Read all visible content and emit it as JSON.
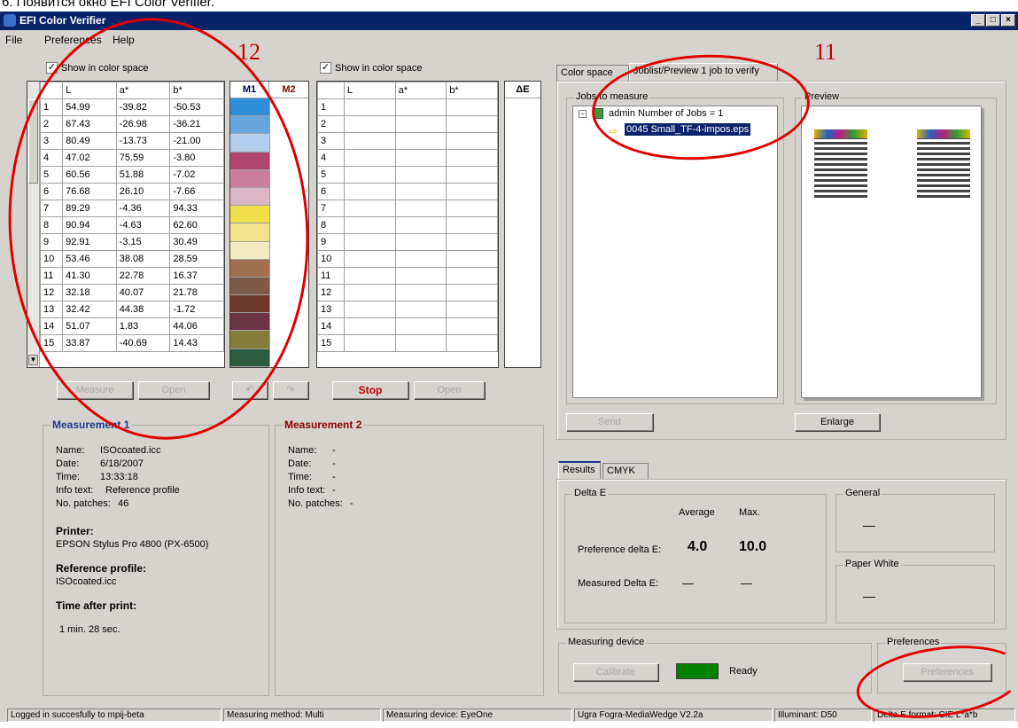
{
  "caption": "6. Появится окно EFI Color Verifier.",
  "window": {
    "title": "EFI Color Verifier",
    "minimize": "_",
    "maximize": "□",
    "close": "×"
  },
  "menu": [
    "File",
    "Preferences",
    "Help"
  ],
  "show_color_space": "Show in color space",
  "m1_table": {
    "headers": [
      "L",
      "a*",
      "b*"
    ],
    "rows": [
      [
        "1",
        "54.99",
        "-39.82",
        "-50.53"
      ],
      [
        "2",
        "67.43",
        "-26.98",
        "-36.21"
      ],
      [
        "3",
        "80.49",
        "-13.73",
        "-21.00"
      ],
      [
        "4",
        "47.02",
        "75.59",
        "-3.80"
      ],
      [
        "5",
        "60.56",
        "51.88",
        "-7.02"
      ],
      [
        "6",
        "76.68",
        "26.10",
        "-7.66"
      ],
      [
        "7",
        "89.29",
        "-4.36",
        "94.33"
      ],
      [
        "8",
        "90.94",
        "-4.63",
        "62.60"
      ],
      [
        "9",
        "92.91",
        "-3.15",
        "30.49"
      ],
      [
        "10",
        "53.46",
        "38.08",
        "28.59"
      ],
      [
        "11",
        "41.30",
        "22.78",
        "16.37"
      ],
      [
        "12",
        "32.18",
        "40.07",
        "21.78"
      ],
      [
        "13",
        "32.42",
        "44.38",
        "-1.72"
      ],
      [
        "14",
        "51.07",
        "1.83",
        "44.06"
      ],
      [
        "15",
        "33.87",
        "-40.69",
        "14.43"
      ]
    ]
  },
  "swatch_headers": [
    "M1",
    "M2"
  ],
  "swatch_colors": [
    "#2f8ed8",
    "#66a6dc",
    "#b3cdec",
    "#b0466e",
    "#cc7f9c",
    "#dcb7c6",
    "#f0e14c",
    "#f4e28a",
    "#f3ebc0",
    "#a07050",
    "#7d5a4a",
    "#6e3a30",
    "#6a3444",
    "#857b3a",
    "#2e5c40"
  ],
  "m2_table": {
    "headers": [
      "L",
      "a*",
      "b*"
    ],
    "row_numbers": [
      "1",
      "2",
      "3",
      "4",
      "5",
      "6",
      "7",
      "8",
      "9",
      "10",
      "11",
      "12",
      "13",
      "14",
      "15"
    ]
  },
  "delta_e_header": "ΔE",
  "buttons": {
    "measure1": "Measure",
    "open1": "Open",
    "undo": "↶",
    "redo": "↷",
    "stop": "Stop",
    "open2": "Open",
    "send": "Send",
    "enlarge": "Enlarge",
    "calibrate": "Calibrate",
    "preferences": "Preferences"
  },
  "measurement1": {
    "title": "Measurement 1",
    "name_label": "Name:",
    "name": "ISOcoated.icc",
    "date_label": "Date:",
    "date": "6/18/2007",
    "time_label": "Time:",
    "time": "13:33:18",
    "info_label": "Info text:",
    "info": "Reference profile",
    "patches_label": "No. patches:",
    "patches": "46",
    "printer_label": "Printer:",
    "printer": "EPSON Stylus Pro 4800 (PX-6500)",
    "ref_label": "Reference profile:",
    "ref": "ISOcoated.icc",
    "tap_label": "Time after print:",
    "tap": "1 min. 28 sec."
  },
  "measurement2": {
    "title": "Measurement 2",
    "name_label": "Name:",
    "name": "-",
    "date_label": "Date:",
    "date": "-",
    "time_label": "Time:",
    "time": "-",
    "info_label": "Info text:",
    "info": "-",
    "patches_label": "No. patches:",
    "patches": "-"
  },
  "top_tabs": [
    "Color space",
    "Joblist/Preview  1 job to verify"
  ],
  "jobs": {
    "group": "Jobs to measure",
    "root": "admin  Number of Jobs = 1",
    "job": "0045 Small_TF-4-impos.eps",
    "expander": "−"
  },
  "preview_group": "Preview",
  "results_tabs": [
    "Results",
    "CMYK"
  ],
  "delta_e": {
    "group": "Delta E",
    "avg_label": "Average",
    "max_label": "Max.",
    "pref_label": "Preference delta E:",
    "pref_avg": "4.0",
    "pref_max": "10.0",
    "meas_label": "Measured  Delta E:",
    "meas_avg": "—",
    "meas_max": "—"
  },
  "general": {
    "group": "General",
    "value": "—"
  },
  "paper_white": {
    "group": "Paper White",
    "value": "—"
  },
  "device": {
    "group": "Measuring device",
    "status": "Ready",
    "led": "#008000"
  },
  "prefs_group": "Preferences",
  "annotations": {
    "n11": "11",
    "n12": "12"
  },
  "status_bar": [
    "Logged in succesfully to mpij-beta",
    "Measuring method: Multi",
    "Measuring device: EyeOne",
    "Ugra Fogra-MediaWedge V2.2a",
    "Illuminant: D50",
    "Delta E format: CIE L*a*b"
  ]
}
